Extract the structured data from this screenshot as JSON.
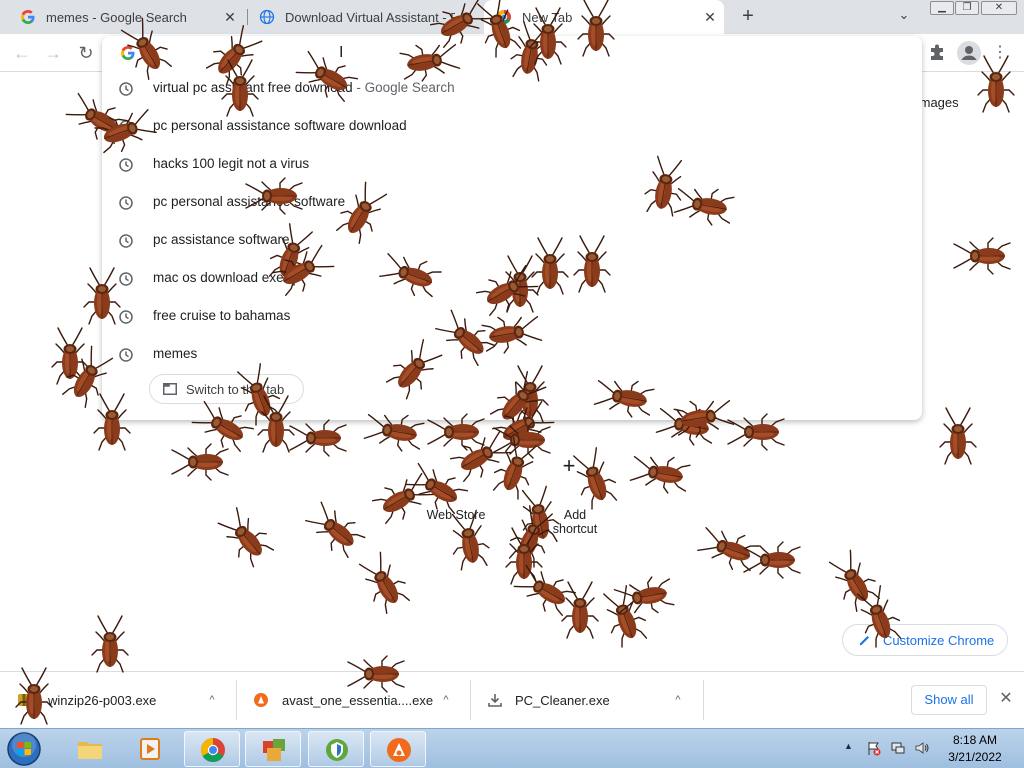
{
  "browser": {
    "tabs": [
      {
        "title": "memes - Google Search",
        "icon": "google-g-icon",
        "active": false
      },
      {
        "title": "Download Virtual Assistant - B",
        "icon": "globe-icon",
        "active": false
      },
      {
        "title": "New Tab",
        "icon": "chrome-icon",
        "active": true
      }
    ],
    "new_tab_glyph": "+",
    "tab_search_glyph": "⌄",
    "window_controls": {
      "minimize": "▁",
      "restore": "❐",
      "close": "✕"
    },
    "nav": {
      "back": "←",
      "forward": "→",
      "reload": "↻",
      "menu": "⋮"
    }
  },
  "omnibox": {
    "caret": "I",
    "suggestions": [
      {
        "text": "virtual pc assistant free download",
        "suffix": " - Google Search"
      },
      {
        "text": "pc personal assistance software download",
        "suffix": ""
      },
      {
        "text": "hacks 100 legit not a virus",
        "suffix": ""
      },
      {
        "text": "pc personal assistance software",
        "suffix": ""
      },
      {
        "text": "pc assistance software",
        "suffix": ""
      },
      {
        "text": "mac os download exe",
        "suffix": ""
      },
      {
        "text": "free cruise to bahamas",
        "suffix": ""
      },
      {
        "text": "memes",
        "suffix": ""
      }
    ],
    "switch_to_tab": "Switch to this tab"
  },
  "ntp": {
    "images_link": "Images",
    "shortcuts": [
      "Web Store",
      "Add shortcut"
    ],
    "add_glyph": "+",
    "customize_label": "Customize Chrome"
  },
  "downloads": {
    "items": [
      {
        "name": "winzip26-p003.exe",
        "icon": "winzip-icon"
      },
      {
        "name": "avast_one_essentia....exe",
        "icon": "avast-icon"
      },
      {
        "name": "PC_Cleaner.exe",
        "icon": "download-tray-icon"
      }
    ],
    "caret": "^",
    "show_all": "Show all",
    "close": "✕"
  },
  "taskbar": {
    "apps": [
      "file-explorer-icon",
      "media-player-icon",
      "chrome-icon",
      "winzip-icon",
      "security-shield-icon",
      "avast-icon"
    ],
    "tray_arrow": "▲",
    "time": "8:18 AM",
    "date": "3/21/2022"
  },
  "colors": {
    "tab_strip": "#dee1e6",
    "accent_blue": "#1a73e8",
    "taskbar": "#a9c6e4",
    "roach_body": "#8a3b1c"
  }
}
